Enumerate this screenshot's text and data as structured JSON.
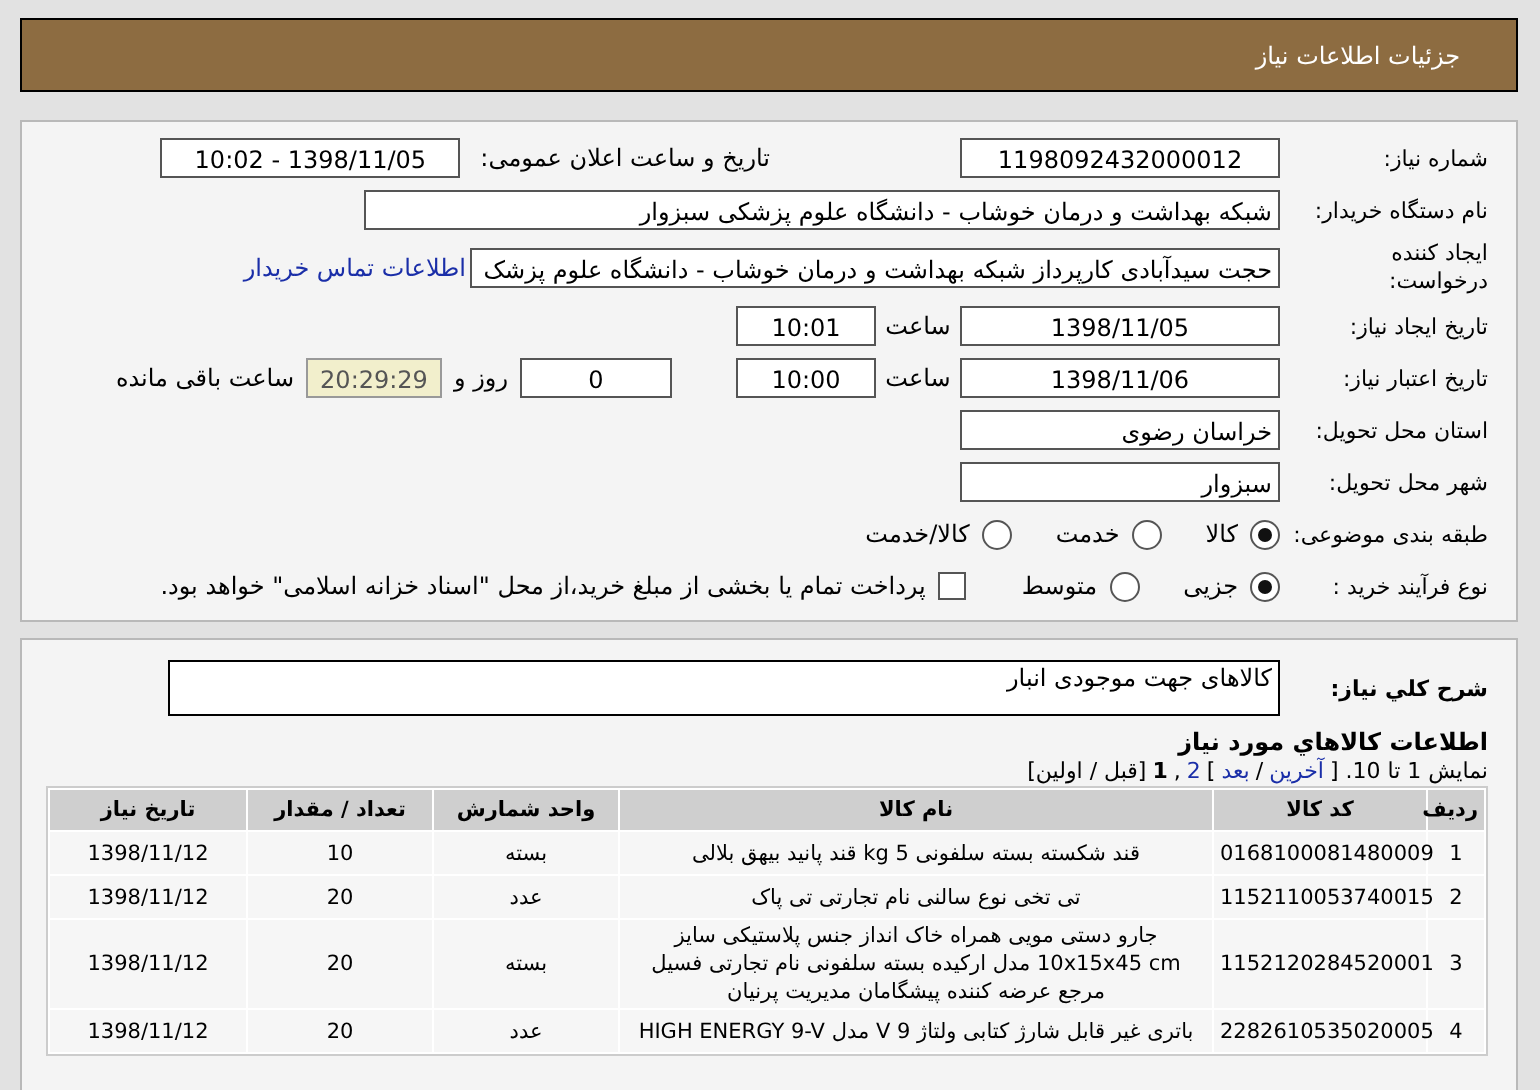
{
  "header": {
    "title": "جزئیات اطلاعات نیاز"
  },
  "need_number": {
    "label": "شماره نیاز:",
    "value": "1198092432000012"
  },
  "announce": {
    "label": "تاریخ و ساعت اعلان عمومی:",
    "value": "1398/11/05 - 10:02"
  },
  "buyer": {
    "label": "نام دستگاه خریدار:",
    "value": "شبکه بهداشت و درمان خوشاب - دانشگاه علوم پزشکی سبزوار"
  },
  "requester": {
    "label": "ایجاد کننده درخواست:",
    "value": "حجت سیدآبادی کارپرداز شبکه بهداشت و درمان خوشاب - دانشگاه علوم پزشک",
    "link": "اطلاعات تماس خریدار"
  },
  "created": {
    "label": "تاریخ ایجاد نیاز:",
    "date": "1398/11/05",
    "time_label": "ساعت",
    "time": "10:01"
  },
  "validity": {
    "label": "تاریخ اعتبار نیاز:",
    "date": "1398/11/06",
    "time_label": "ساعت",
    "time": "10:00",
    "days": "0",
    "days_label": "روز و",
    "remaining": "20:29:29",
    "remaining_label": "ساعت باقی مانده"
  },
  "province": {
    "label": "استان محل تحویل:",
    "value": "خراسان رضوی"
  },
  "city": {
    "label": "شهر محل تحویل:",
    "value": "سبزوار"
  },
  "category": {
    "label": "طبقه بندی موضوعی:",
    "options": [
      {
        "label": "کالا",
        "selected": true
      },
      {
        "label": "خدمت",
        "selected": false
      },
      {
        "label": "کالا/خدمت",
        "selected": false
      }
    ]
  },
  "process": {
    "label": "نوع فرآیند خرید :",
    "options": [
      {
        "label": "جزیی",
        "selected": true
      },
      {
        "label": "متوسط",
        "selected": false
      }
    ],
    "payment": {
      "checked": false,
      "label": "پرداخت تمام یا بخشی از مبلغ خرید،از محل \"اسناد خزانه اسلامی\" خواهد بود."
    }
  },
  "description": {
    "label": "شرح کلي نياز:",
    "value": "کالاهای جهت موجودی انبار"
  },
  "goods": {
    "title": "اطلاعات کالاهاي مورد نياز",
    "pagination": [
      {
        "kind": "text",
        "text": "نمایش 1 تا 10. ["
      },
      {
        "kind": "link",
        "text": "آخرین"
      },
      {
        "kind": "text",
        "text": "/"
      },
      {
        "kind": "link",
        "text": "بعد"
      },
      {
        "kind": "text",
        "text": "]"
      },
      {
        "kind": "link",
        "text": "2"
      },
      {
        "kind": "text",
        "text": ","
      },
      {
        "kind": "current",
        "text": "1"
      },
      {
        "kind": "text",
        "text": "[قبل / اولین]"
      }
    ],
    "columns": [
      "ردیف",
      "کد کالا",
      "نام کالا",
      "واحد شمارش",
      "تعداد / مقدار",
      "تاریخ نیاز"
    ],
    "rows": [
      [
        "1",
        "0168100081480009",
        "قند شکسته بسته سلفونی 5 kg قند پانید بیهق بلالی",
        "بسته",
        "10",
        "1398/11/12"
      ],
      [
        "2",
        "1152110053740015",
        "تی تخی نوع سالنی نام تجارتی تی پاک",
        "عدد",
        "20",
        "1398/11/12"
      ],
      [
        "3",
        "1152120284520001",
        "جارو دستی مویی همراه خاک انداز جنس پلاستیکی سایز 10x15x45 cm مدل ارکیده بسته سلفونی نام تجارتی فسیل مرجع عرضه کننده پیشگامان مدیریت پرنیان",
        "بسته",
        "20",
        "1398/11/12"
      ],
      [
        "4",
        "2282610535020005",
        "باتری غیر قابل شارژ کتابی ولتاژ 9 V مدل HIGH ENERGY 9-V",
        "عدد",
        "20",
        "1398/11/12"
      ]
    ]
  }
}
